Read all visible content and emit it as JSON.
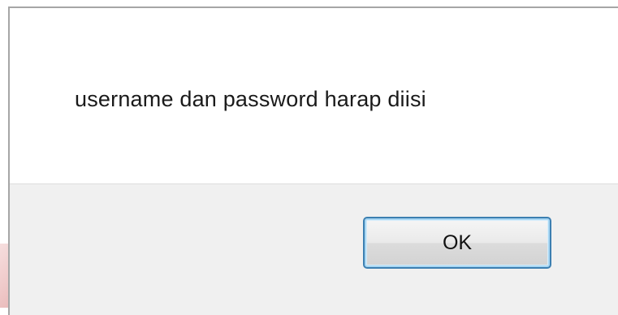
{
  "dialog": {
    "message": "username dan password harap diisi",
    "ok_label": "OK"
  },
  "colors": {
    "message_bg": "#ffffff",
    "button_area_bg": "#f0f0f0",
    "button_border": "#3c7fb1",
    "background_accent": "#efc9c9"
  }
}
